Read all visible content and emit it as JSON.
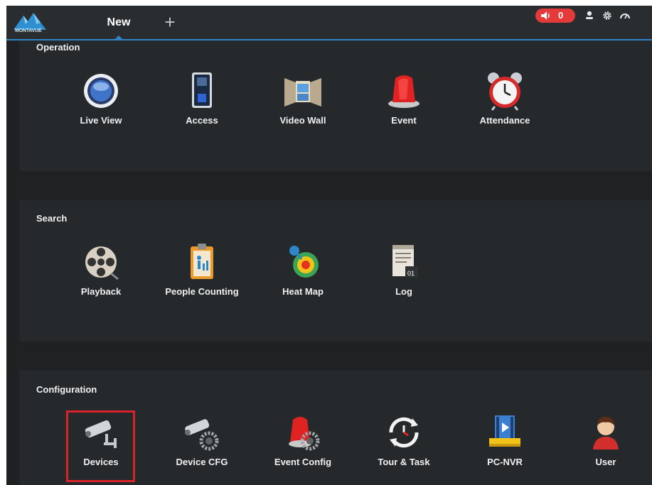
{
  "header": {
    "brand": "MONTAVUE",
    "tab_label": "New",
    "add_tab_symbol": "+",
    "alarm_count": "0",
    "icons": [
      "speaker-icon",
      "user-icon",
      "gear-icon",
      "gauge-icon"
    ]
  },
  "sections": [
    {
      "title": "Operation",
      "items": [
        {
          "label": "Live View",
          "icon": "live-view-icon"
        },
        {
          "label": "Access",
          "icon": "access-icon"
        },
        {
          "label": "Video Wall",
          "icon": "video-wall-icon"
        },
        {
          "label": "Event",
          "icon": "event-icon"
        },
        {
          "label": "Attendance",
          "icon": "alarm-clock-icon"
        }
      ]
    },
    {
      "title": "Search",
      "items": [
        {
          "label": "Playback",
          "icon": "film-reel-icon"
        },
        {
          "label": "People Counting",
          "icon": "people-counting-icon"
        },
        {
          "label": "Heat Map",
          "icon": "heat-map-icon"
        },
        {
          "label": "Log",
          "icon": "log-icon"
        }
      ]
    },
    {
      "title": "Configuration",
      "items": [
        {
          "label": "Devices",
          "icon": "camera-icon"
        },
        {
          "label": "Device CFG",
          "icon": "camera-gear-icon"
        },
        {
          "label": "Event Config",
          "icon": "event-gear-icon"
        },
        {
          "label": "Tour & Task",
          "icon": "tour-clock-icon"
        },
        {
          "label": "PC-NVR",
          "icon": "pc-nvr-icon"
        },
        {
          "label": "User",
          "icon": "user-avatar-icon"
        }
      ]
    }
  ],
  "colors": {
    "accent": "#2e86c9",
    "background": "#1f2123",
    "panel": "#26292c",
    "alarm": "#e43a3a",
    "highlight": "#d8232a"
  }
}
